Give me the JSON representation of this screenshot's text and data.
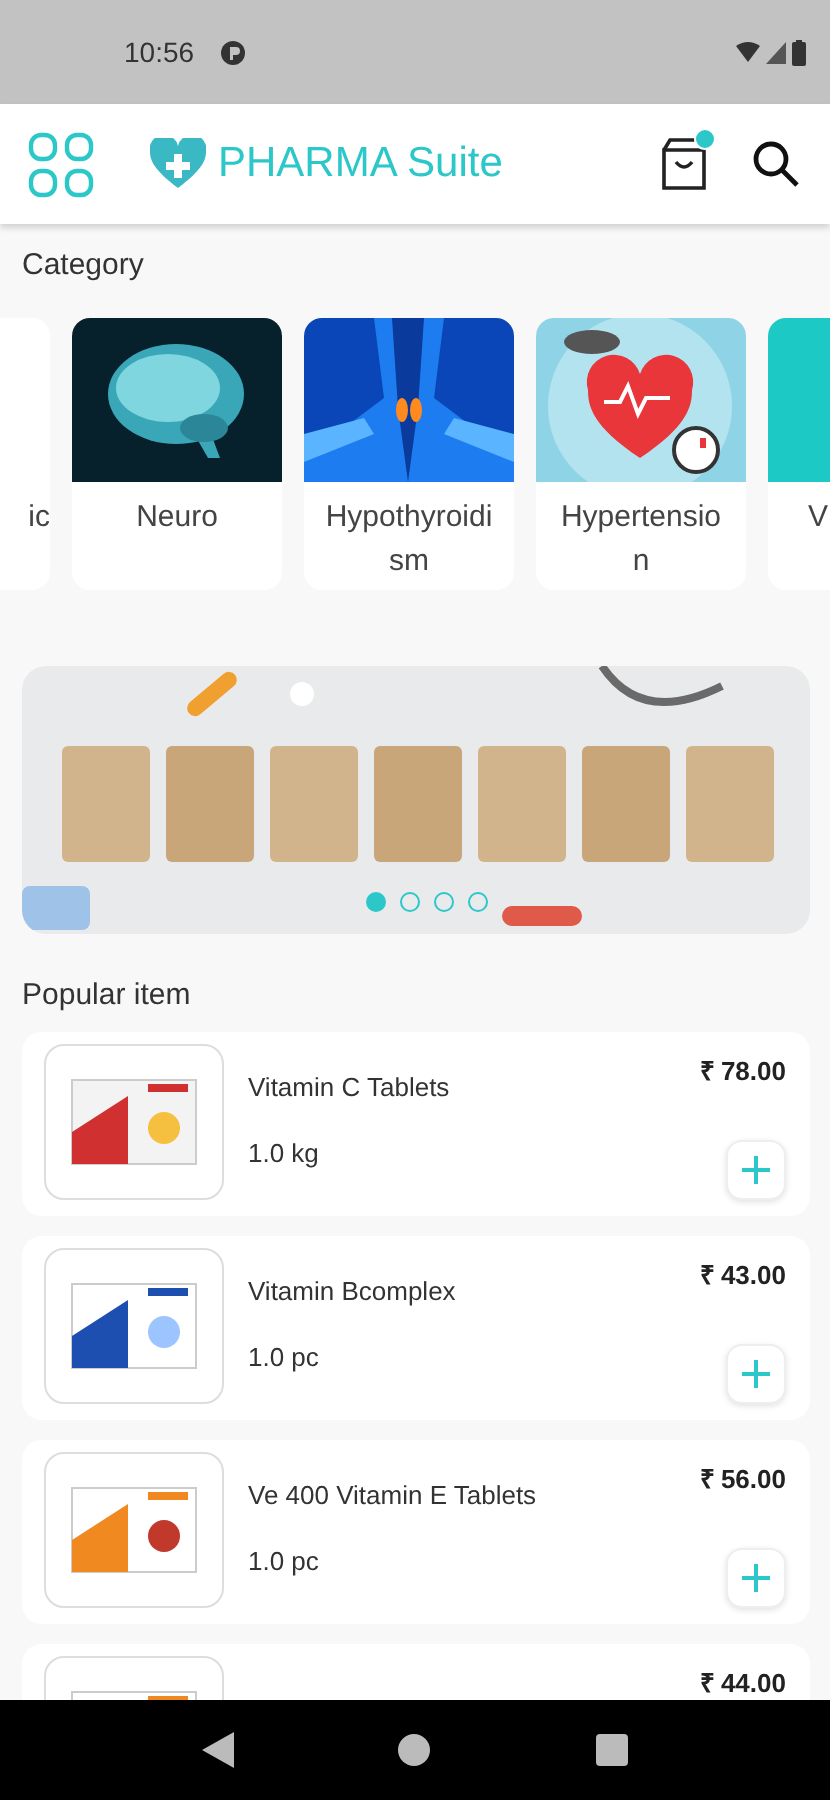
{
  "status_bar": {
    "time": "10:56"
  },
  "header": {
    "title": "PHARMA Suite",
    "cart_badge": true
  },
  "category": {
    "heading": "Category",
    "items": [
      {
        "label": "ic",
        "kind": "cut_left"
      },
      {
        "label": "Neuro",
        "kind": "full"
      },
      {
        "label": "Hypothyroidism",
        "kind": "full"
      },
      {
        "label": "Hypertension",
        "kind": "full"
      },
      {
        "label": "V",
        "kind": "cut_right"
      }
    ]
  },
  "banner": {
    "dots": [
      {
        "selected": true
      },
      {
        "selected": false
      },
      {
        "selected": false
      },
      {
        "selected": false
      }
    ]
  },
  "popular": {
    "heading": "Popular item",
    "items": [
      {
        "name": "Vitamin C Tablets",
        "unit": "1.0 kg",
        "price": "₹ 78.00"
      },
      {
        "name": "Vitamin Bcomplex",
        "unit": "1.0 pc",
        "price": "₹ 43.00"
      },
      {
        "name": "Ve 400 Vitamin E Tablets",
        "unit": "1.0 pc",
        "price": "₹ 56.00"
      },
      {
        "price": "₹ 44.00"
      }
    ]
  }
}
